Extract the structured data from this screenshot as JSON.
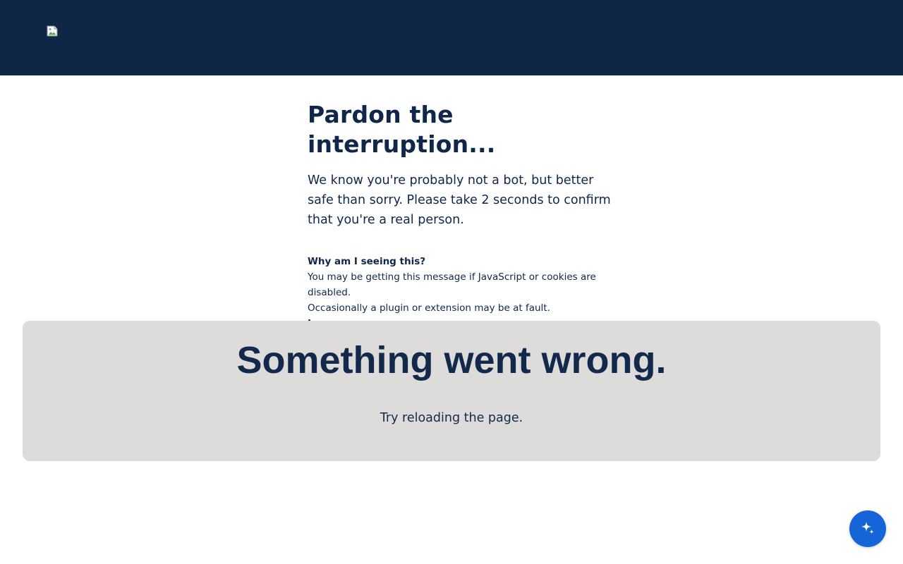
{
  "header": {
    "logo_icon": "broken-image-icon",
    "background_color": "#102645"
  },
  "main": {
    "title": "Pardon the interruption...",
    "intro": "We know you're probably not a bot, but better safe than sorry. Please take 2 seconds to confirm that you're a real person.",
    "why": {
      "title": "Why am I seeing this?",
      "line1": "You may be getting this message if JavaScript or cookies are disabled.",
      "line2": "Occasionally a plugin or extension may be at fault.",
      "learn_more": "Learn more"
    }
  },
  "error_panel": {
    "title": "Something went wrong.",
    "hint": "Try reloading the page.",
    "background_color": "#dedcdb"
  },
  "assistant_button": {
    "icon": "sparkle-icon",
    "color": "#1565d8"
  }
}
